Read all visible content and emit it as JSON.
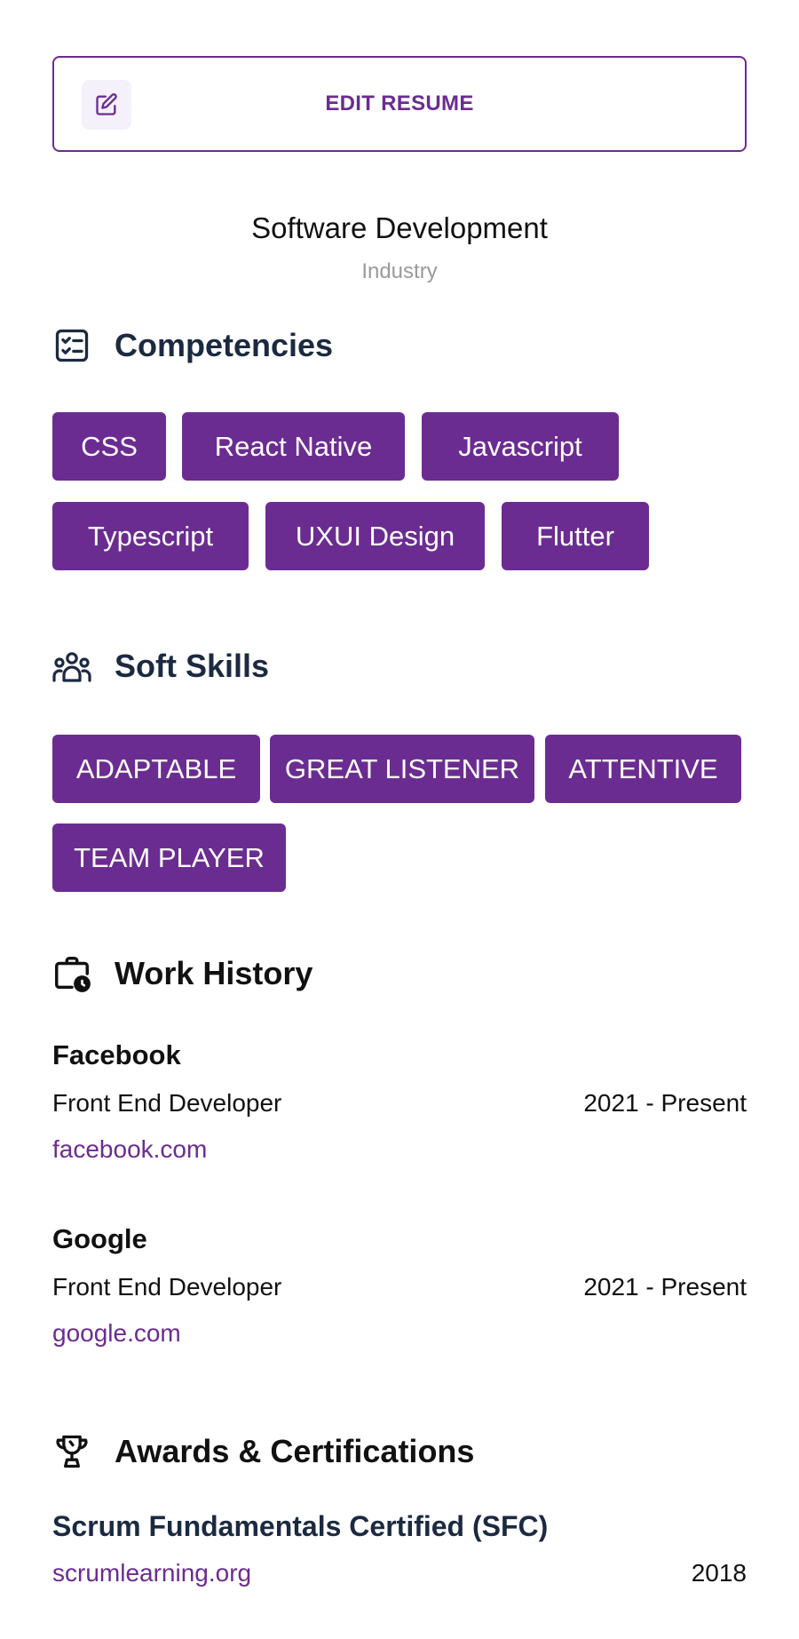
{
  "edit_button": {
    "label": "EDIT RESUME"
  },
  "industry": {
    "value": "Software Development",
    "label": "Industry"
  },
  "competencies": {
    "title": "Competencies",
    "items": [
      "CSS",
      "React Native",
      "Javascript",
      "Typescript",
      "UXUI Design",
      "Flutter"
    ]
  },
  "soft_skills": {
    "title": "Soft Skills",
    "items": [
      "ADAPTABLE",
      "GREAT LISTENER",
      "ATTENTIVE",
      "TEAM PLAYER"
    ]
  },
  "work_history": {
    "title": "Work History",
    "jobs": [
      {
        "company": "Facebook",
        "role": "Front End Developer",
        "period": "2021 - Present",
        "link": "facebook.com"
      },
      {
        "company": "Google",
        "role": "Front End Developer",
        "period": "2021 - Present",
        "link": "google.com"
      }
    ]
  },
  "awards": {
    "title": "Awards & Certifications",
    "items": [
      {
        "title": "Scrum Fundamentals Certified (SFC)",
        "link": "scrumlearning.org",
        "year": "2018"
      }
    ]
  },
  "colors": {
    "accent": "#6b2c91",
    "heading": "#1b2a41",
    "muted": "#9a9a9a"
  },
  "icons": {
    "edit": "edit-icon",
    "competencies": "checklist-icon",
    "soft_skills": "people-group-icon",
    "work_history": "briefcase-clock-icon",
    "awards": "trophy-icon"
  }
}
